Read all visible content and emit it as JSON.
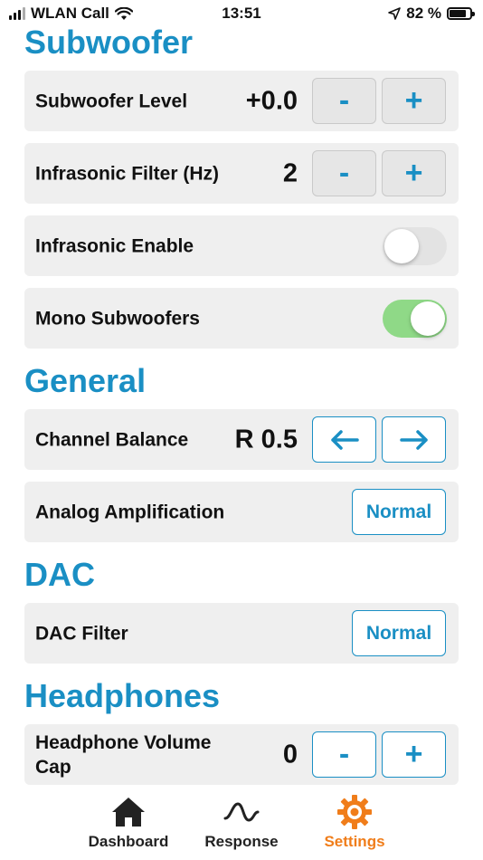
{
  "status_bar": {
    "carrier": "WLAN Call",
    "time": "13:51",
    "battery_percent": "82 %",
    "battery_level": 0.82
  },
  "sections": {
    "subwoofer": {
      "title": "Subwoofer",
      "level": {
        "label": "Subwoofer Level",
        "value": "+0.0",
        "minus": "-",
        "plus": "+"
      },
      "infrasonic_filter": {
        "label": "Infrasonic Filter (Hz)",
        "value": "2",
        "minus": "-",
        "plus": "+"
      },
      "infrasonic_enable": {
        "label": "Infrasonic Enable",
        "on": false
      },
      "mono_subwoofers": {
        "label": "Mono Subwoofers",
        "on": true
      }
    },
    "general": {
      "title": "General",
      "channel_balance": {
        "label": "Channel Balance",
        "value": "R 0.5",
        "left": "←",
        "right": "→"
      },
      "analog_amplification": {
        "label": "Analog Amplification",
        "button": "Normal"
      }
    },
    "dac": {
      "title": "DAC",
      "dac_filter": {
        "label": "DAC Filter",
        "button": "Normal"
      }
    },
    "headphones": {
      "title": "Headphones",
      "volume_cap": {
        "label_line1": "Headphone Volume",
        "label_line2": "Cap",
        "value": "0",
        "minus": "-",
        "plus": "+"
      }
    }
  },
  "tabbar": {
    "tabs": [
      {
        "label": "Dashboard",
        "icon": "house-icon",
        "active": false
      },
      {
        "label": "Response",
        "icon": "waveform-icon",
        "active": false
      },
      {
        "label": "Settings",
        "icon": "gear-icon",
        "active": true
      }
    ],
    "active_color": "#f07d1a",
    "inactive_color": "#222222"
  },
  "colors": {
    "accent": "#1a8fc4",
    "toggle_on": "#8fd987",
    "toggle_off": "#e3e3e3",
    "row_bg": "#efefef"
  }
}
